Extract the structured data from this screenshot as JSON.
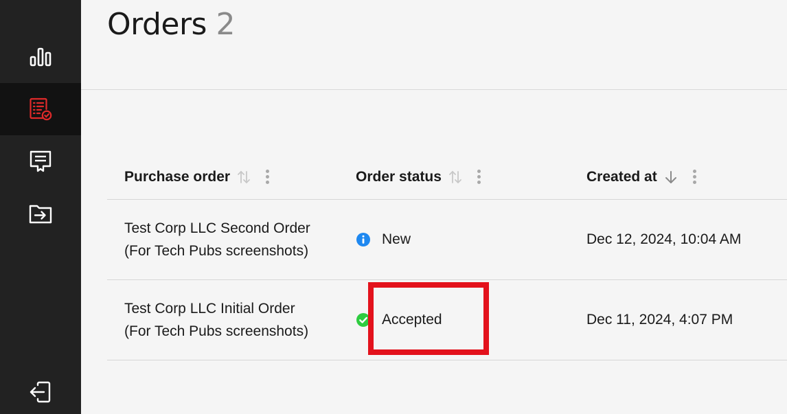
{
  "sidebar": {
    "items": [
      {
        "icon": "bar-chart-icon",
        "active": false
      },
      {
        "icon": "orders-list-check-icon",
        "active": true,
        "accent": "#e02a2a"
      },
      {
        "icon": "message-certificate-icon",
        "active": false
      },
      {
        "icon": "folder-import-icon",
        "active": false
      }
    ],
    "bottom": {
      "icon": "logout-icon"
    }
  },
  "page": {
    "title": "Orders",
    "count": "2"
  },
  "table": {
    "columns": [
      {
        "label": "Purchase order",
        "sort": "unsorted"
      },
      {
        "label": "Order status",
        "sort": "unsorted"
      },
      {
        "label": "Created at",
        "sort": "descending"
      }
    ],
    "rows": [
      {
        "po_line1": "Test Corp LLC Second Order",
        "po_line2": "(For Tech Pubs screenshots)",
        "status": "New",
        "status_icon": "info-icon",
        "status_color": "#1e88f0",
        "created_at": "Dec 12, 2024, 10:04 AM"
      },
      {
        "po_line1": "Test Corp LLC Initial Order",
        "po_line2": "(For Tech Pubs screenshots)",
        "status": "Accepted",
        "status_icon": "check-circle-icon",
        "status_color": "#2ecc40",
        "created_at": "Dec 11, 2024, 4:07 PM"
      }
    ]
  },
  "annotation": {
    "color": "#e3121c"
  }
}
